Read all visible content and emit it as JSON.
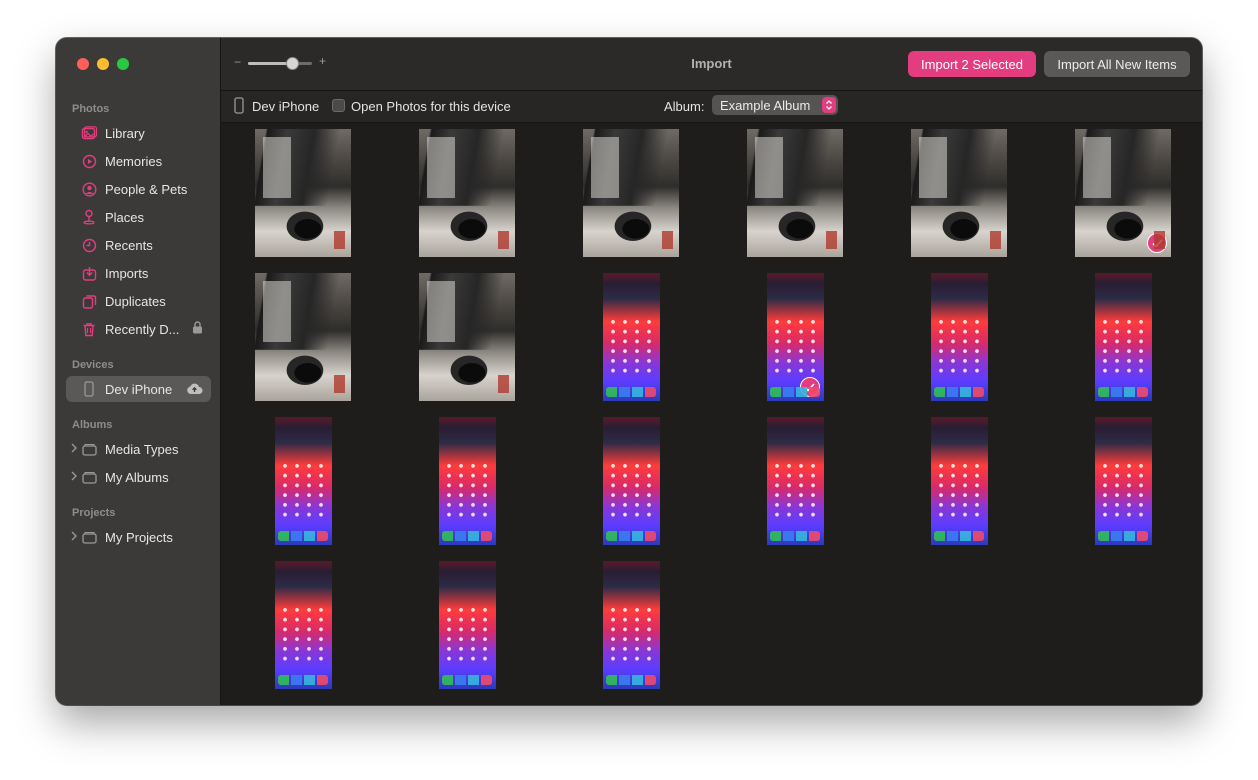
{
  "window": {
    "title": "Import"
  },
  "toolbar": {
    "zoom_minus": "−",
    "zoom_plus": "+",
    "zoom_level": 0.68,
    "import_selected_label": "Import 2 Selected",
    "import_all_label": "Import All New Items"
  },
  "subbar": {
    "device_name": "Dev iPhone",
    "open_photos_label": "Open Photos for this device",
    "open_photos_checked": false,
    "album_label": "Album:",
    "album_value": "Example Album"
  },
  "sidebar": {
    "photos_title": "Photos",
    "photos": [
      {
        "label": "Library",
        "icon": "library-icon"
      },
      {
        "label": "Memories",
        "icon": "memories-icon"
      },
      {
        "label": "People & Pets",
        "icon": "people-icon"
      },
      {
        "label": "Places",
        "icon": "places-icon"
      },
      {
        "label": "Recents",
        "icon": "recents-icon"
      },
      {
        "label": "Imports",
        "icon": "imports-icon"
      },
      {
        "label": "Duplicates",
        "icon": "duplicates-icon"
      },
      {
        "label": "Recently D...",
        "icon": "trash-icon",
        "trailing": "lock-icon"
      }
    ],
    "devices_title": "Devices",
    "devices": [
      {
        "label": "Dev iPhone",
        "icon": "iphone-icon",
        "trailing": "cloud-upload-icon",
        "selected": true
      }
    ],
    "albums_title": "Albums",
    "albums": [
      {
        "label": "Media Types",
        "icon": "folder-icon"
      },
      {
        "label": "My Albums",
        "icon": "folder-icon"
      }
    ],
    "projects_title": "Projects",
    "projects": [
      {
        "label": "My Projects",
        "icon": "folder-icon"
      }
    ]
  },
  "colors": {
    "accent": "#e33d80",
    "sidebar_bg": "#3b3a39",
    "content_bg": "#1e1d1c"
  },
  "grid": {
    "columns": 6,
    "photos": [
      {
        "kind": "desk-photo",
        "selected": false
      },
      {
        "kind": "desk-photo",
        "selected": false
      },
      {
        "kind": "desk-photo",
        "selected": false
      },
      {
        "kind": "desk-photo",
        "selected": false
      },
      {
        "kind": "desk-photo",
        "selected": false
      },
      {
        "kind": "desk-photo",
        "selected": true
      },
      {
        "kind": "desk-photo",
        "selected": false
      },
      {
        "kind": "desk-photo",
        "selected": false
      },
      {
        "kind": "phone-screenshot",
        "selected": false
      },
      {
        "kind": "phone-screenshot",
        "selected": true
      },
      {
        "kind": "phone-screenshot",
        "selected": false
      },
      {
        "kind": "phone-screenshot",
        "selected": false
      },
      {
        "kind": "phone-screenshot",
        "selected": false
      },
      {
        "kind": "phone-screenshot",
        "selected": false
      },
      {
        "kind": "phone-screenshot",
        "selected": false
      },
      {
        "kind": "phone-screenshot",
        "selected": false
      },
      {
        "kind": "phone-screenshot",
        "selected": false
      },
      {
        "kind": "phone-screenshot",
        "selected": false
      },
      {
        "kind": "phone-screenshot",
        "selected": false
      },
      {
        "kind": "phone-screenshot",
        "selected": false
      },
      {
        "kind": "phone-screenshot",
        "selected": false
      }
    ]
  }
}
